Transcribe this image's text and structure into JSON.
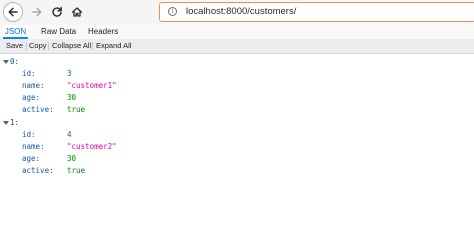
{
  "browser": {
    "url": "localhost:8000/customers/"
  },
  "viewer": {
    "tabs": [
      "JSON",
      "Raw Data",
      "Headers"
    ],
    "toolbar": [
      "Save",
      "Copy",
      "Collapse All",
      "Expand All"
    ]
  },
  "records": [
    {
      "index_label": "0:",
      "fields": [
        {
          "key": "id:",
          "value": "3"
        },
        {
          "key": "name:",
          "value": "\"customer1\""
        },
        {
          "key": "age:",
          "value": "30"
        },
        {
          "key": "active:",
          "value": "true"
        }
      ]
    },
    {
      "index_label": "1:",
      "fields": [
        {
          "key": "id:",
          "value": "4"
        },
        {
          "key": "name:",
          "value": "\"customer2\""
        },
        {
          "key": "age:",
          "value": "30"
        },
        {
          "key": "active:",
          "value": "true"
        }
      ]
    }
  ],
  "colors": {
    "accent": "#0a84ff",
    "string": "#dd00a9",
    "number": "#058b00",
    "key": "#1a58a8",
    "urlbar_focus": "#f08c5f"
  },
  "icons": [
    "back-arrow-icon",
    "forward-arrow-icon",
    "reload-icon",
    "home-icon",
    "info-icon",
    "twisty-expanded-icon"
  ]
}
